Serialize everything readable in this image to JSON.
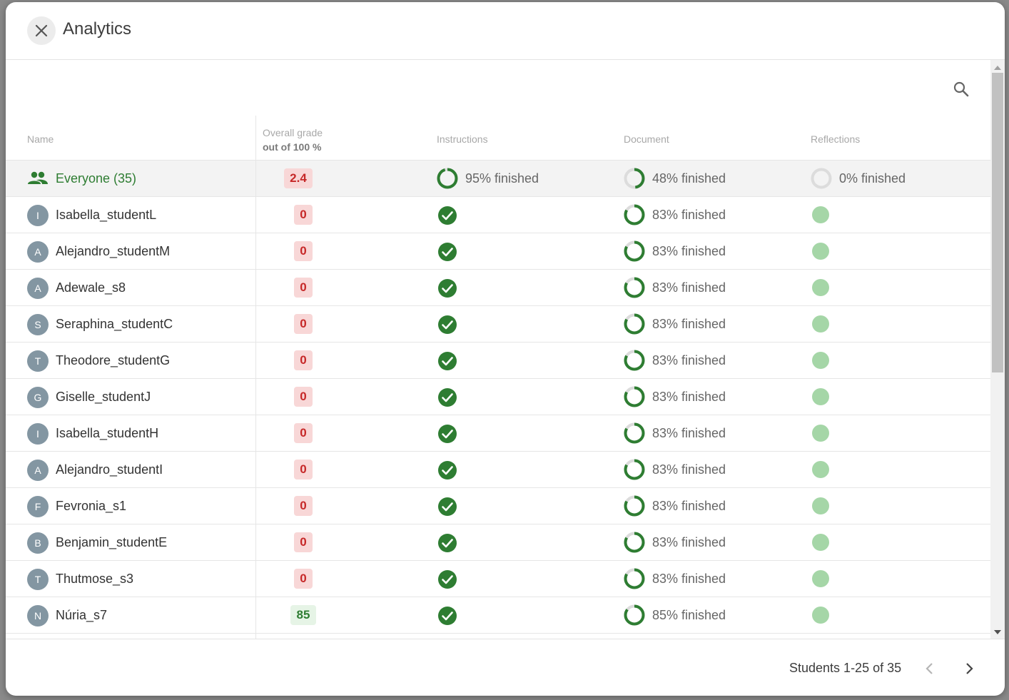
{
  "header": {
    "title": "Analytics"
  },
  "columns": {
    "name": "Name",
    "grade": "Overall grade",
    "grade_sub": "out of 100 %",
    "instructions": "Instructions",
    "document": "Document",
    "reflections": "Reflections"
  },
  "everyone": {
    "label": "Everyone (35)",
    "grade": "2.4",
    "instructions_label": "95% finished",
    "instructions_progress": 0.95,
    "document_label": "48% finished",
    "document_progress": 0.48,
    "reflections_label": "0% finished",
    "reflections_progress": 0
  },
  "students": [
    {
      "initial": "I",
      "name": "Isabella_studentL",
      "grade": "0",
      "grade_status": "low",
      "document_label": "83% finished",
      "document_progress": 0.83
    },
    {
      "initial": "A",
      "name": "Alejandro_studentM",
      "grade": "0",
      "grade_status": "low",
      "document_label": "83% finished",
      "document_progress": 0.83
    },
    {
      "initial": "A",
      "name": "Adewale_s8",
      "grade": "0",
      "grade_status": "low",
      "document_label": "83% finished",
      "document_progress": 0.83
    },
    {
      "initial": "S",
      "name": "Seraphina_studentC",
      "grade": "0",
      "grade_status": "low",
      "document_label": "83% finished",
      "document_progress": 0.83
    },
    {
      "initial": "T",
      "name": "Theodore_studentG",
      "grade": "0",
      "grade_status": "low",
      "document_label": "83% finished",
      "document_progress": 0.83
    },
    {
      "initial": "G",
      "name": "Giselle_studentJ",
      "grade": "0",
      "grade_status": "low",
      "document_label": "83% finished",
      "document_progress": 0.83
    },
    {
      "initial": "I",
      "name": "Isabella_studentH",
      "grade": "0",
      "grade_status": "low",
      "document_label": "83% finished",
      "document_progress": 0.83
    },
    {
      "initial": "A",
      "name": "Alejandro_studentI",
      "grade": "0",
      "grade_status": "low",
      "document_label": "83% finished",
      "document_progress": 0.83
    },
    {
      "initial": "F",
      "name": "Fevronia_s1",
      "grade": "0",
      "grade_status": "low",
      "document_label": "83% finished",
      "document_progress": 0.83
    },
    {
      "initial": "B",
      "name": "Benjamin_studentE",
      "grade": "0",
      "grade_status": "low",
      "document_label": "83% finished",
      "document_progress": 0.83
    },
    {
      "initial": "T",
      "name": "Thutmose_s3",
      "grade": "0",
      "grade_status": "low",
      "document_label": "83% finished",
      "document_progress": 0.83
    },
    {
      "initial": "N",
      "name": "Núria_s7",
      "grade": "85",
      "grade_status": "high",
      "document_label": "85% finished",
      "document_progress": 0.85
    }
  ],
  "footer": {
    "pagination": "Students 1-25 of 35"
  },
  "colors": {
    "accent_green": "#2e7d32",
    "grade_low_bg": "#f8d7d7",
    "grade_low_text": "#c62828",
    "grade_high_bg": "#e6f4e6",
    "reflection_dot": "#a5d6a7",
    "avatar_bg": "#8396a2"
  },
  "icons": {
    "close": "close-icon",
    "search": "search-icon",
    "group": "group-icon",
    "check": "check-circle-icon",
    "prev": "chevron-left-icon",
    "next": "chevron-right-icon"
  }
}
